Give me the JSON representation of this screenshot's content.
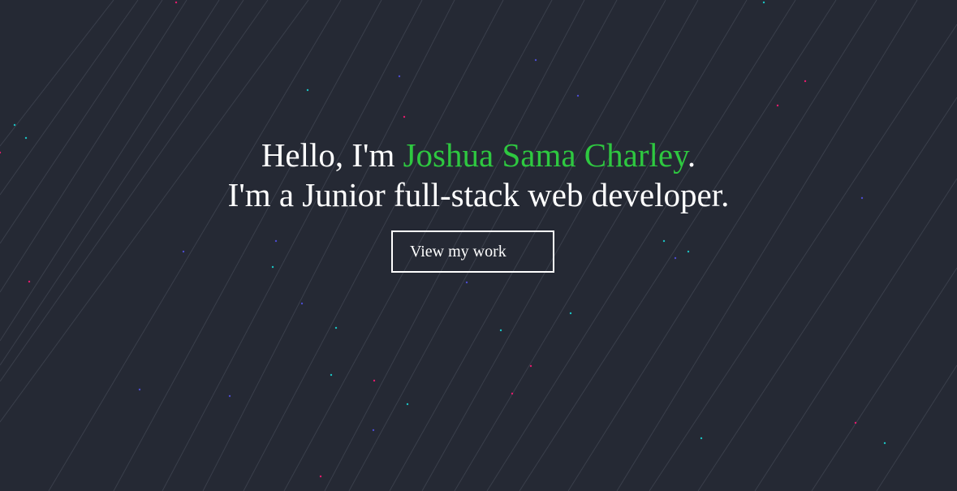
{
  "hero": {
    "greeting_prefix": "Hello, I'm ",
    "name": "Joshua Sama Charley",
    "greeting_suffix": ".",
    "tagline": "I'm a Junior full-stack web developer."
  },
  "cta": {
    "label": "View my work"
  },
  "colors": {
    "background": "#252934",
    "accent": "#2ec840",
    "text": "#ffffff",
    "streak": "#3a3f4b",
    "particles": [
      "#e31b6d",
      "#1bc2c2",
      "#4c4ccc"
    ]
  }
}
